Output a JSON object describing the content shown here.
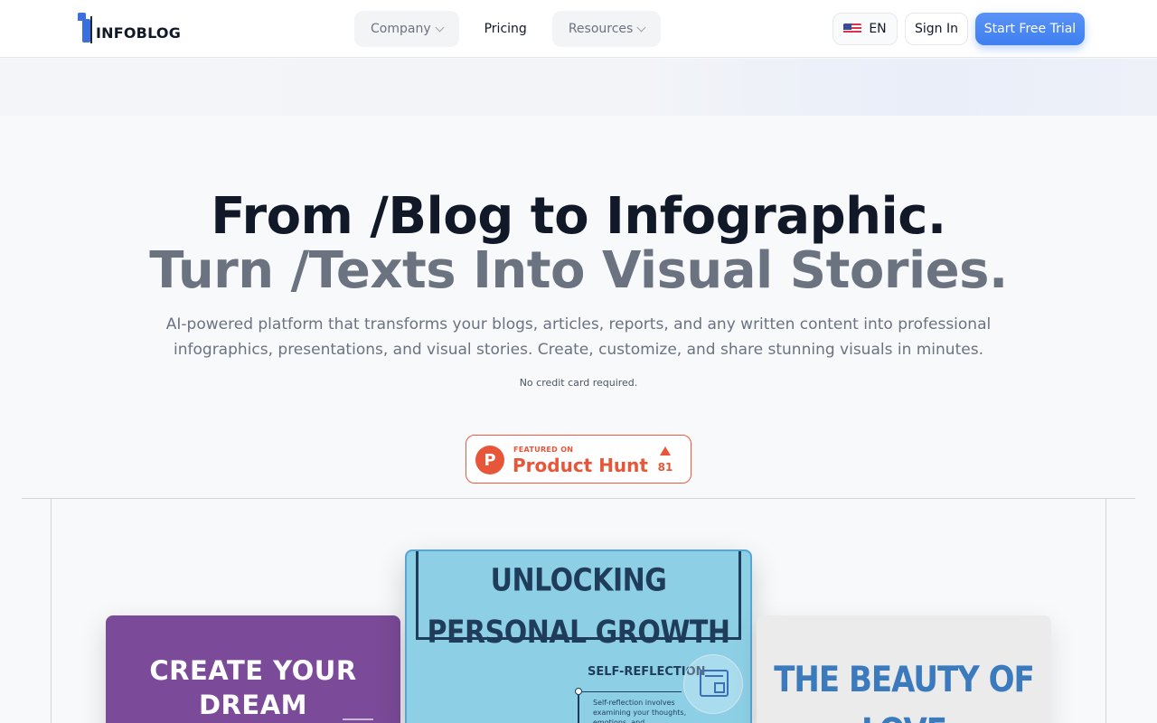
{
  "header": {
    "logo_text": "INFOBLOG",
    "nav": [
      {
        "label": "Company"
      },
      {
        "label": "Pricing"
      },
      {
        "label": "Resources"
      }
    ],
    "language": "EN",
    "sign_in": "Sign In",
    "cta": "Start Free Trial"
  },
  "hero": {
    "title_line1": "From /Blog to Infographic.",
    "title_line2": "Turn /Texts Into Visual Stories.",
    "description": "AI-powered platform that transforms your blogs, articles, reports, and any written content into professional infographics, presentations, and visual stories. Create, customize, and share stunning visuals in minutes.",
    "note": "No credit card required."
  },
  "product_hunt": {
    "featured_label": "FEATURED ON",
    "name": "Product Hunt",
    "letter": "P",
    "upvotes": "81"
  },
  "showcase": {
    "left_card_title": "CREATE YOUR DREAM",
    "center_card_title": "UNLOCKING PERSONAL GROWTH",
    "center_card_subtitle": "SELF-REFLECTION",
    "center_card_body": "Self-reflection involves examining your thoughts, emotions, and",
    "right_card_title": "THE BEAUTY OF LOVE"
  },
  "colors": {
    "accent": "#3f7ff0",
    "product_hunt": "#e8563a",
    "card_purple": "#7b4a98",
    "card_blue": "#8dd0e6",
    "card_grey": "#ebebeb"
  }
}
